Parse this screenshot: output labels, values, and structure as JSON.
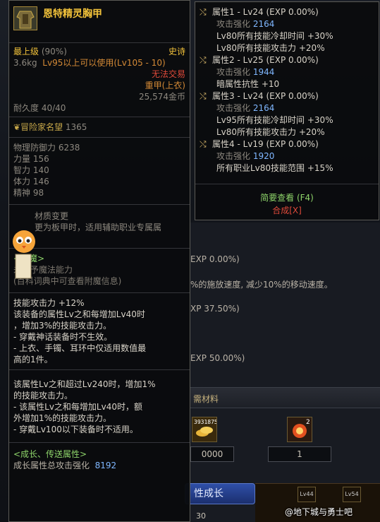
{
  "item": {
    "name": "恩特精灵胸甲",
    "quality": "最上级",
    "quality_pct": "(90%)",
    "rarity": "史诗",
    "weight": "3.6kg",
    "level_req": "Lv95以上可以使用(Lv105 - 10)",
    "trade": "无法交易",
    "type": "重甲(上衣)",
    "price": "25,574金币",
    "durability": "耐久度 40/40",
    "fame": "冒险家名望",
    "fame_value": "1365",
    "stats": [
      {
        "label": "物理防御力",
        "value": "6238"
      },
      {
        "label": "力量",
        "value": "156"
      },
      {
        "label": "智力",
        "value": "140"
      },
      {
        "label": "体力",
        "value": "146"
      },
      {
        "label": "精神",
        "value": "98"
      }
    ],
    "material_title": "材质变更",
    "material_desc": "更为板甲时，适用辅助职业专属属",
    "enchant_title": "<附魔>",
    "enchant_line1": "未赋予魔法能力",
    "enchant_line2": "(百科词典中可查看附魔信息)",
    "effect_lines": [
      "技能攻击力 +12%",
      "该装备的属性Lv之和每增加Lv40时",
      "，增加3%的技能攻击力。",
      "- 穿戴神话装备时不生效。",
      "- 上衣、手镯、耳环中仅适用数值最",
      "高的1件。"
    ],
    "effect2_lines": [
      "该属性Lv之和超过Lv240时，增加1%",
      "的技能攻击力。",
      "- 该属性Lv之和每增加Lv40时，额",
      "外增加1%的技能攻击力。",
      "- 穿戴Lv100以下装备时不适用。"
    ],
    "growth_title": "<成长、传送属性>",
    "growth_label": "成长属性总攻击强化",
    "growth_value": "8192"
  },
  "attributes": [
    {
      "head": "属性1 - Lv24 (EXP 0.00%)",
      "atk_label": "攻击强化",
      "atk": "2164",
      "lines": [
        "Lv80所有技能冷却时间 +30%",
        "Lv80所有技能攻击力 +20%"
      ]
    },
    {
      "head": "属性2 - Lv25 (EXP 0.00%)",
      "atk_label": "攻击强化",
      "atk": "1944",
      "lines": [
        "暗属性抗性 +10"
      ]
    },
    {
      "head": "属性3 - Lv24 (EXP 0.00%)",
      "atk_label": "攻击强化",
      "atk": "2164",
      "lines": [
        "Lv95所有技能冷却时间 +30%",
        "Lv80所有技能攻击力 +20%"
      ]
    },
    {
      "head": "属性4 - Lv19 (EXP 0.00%)",
      "atk_label": "攻击强化",
      "atk": "1920",
      "lines": [
        "所有职业Lv80技能范围 +15%"
      ]
    }
  ],
  "links": {
    "brief": "简要查看 (F4)",
    "synth": "合成[X]"
  },
  "background": {
    "line1": "EXP 0.00%)",
    "line2": "%的施放速度, 减少10%的移动速度。",
    "line3": "XP 37.50%)",
    "line4": "EXP 50.00%)",
    "section": "需材料",
    "count_a": "3931875",
    "count_b": "2",
    "box_a": "0000",
    "box_b": "1",
    "grow_btn": "性成长",
    "lv_a": "Lv44",
    "lv_b": "Lv54",
    "num": "30"
  },
  "watermark": "@地下城与勇士吧"
}
